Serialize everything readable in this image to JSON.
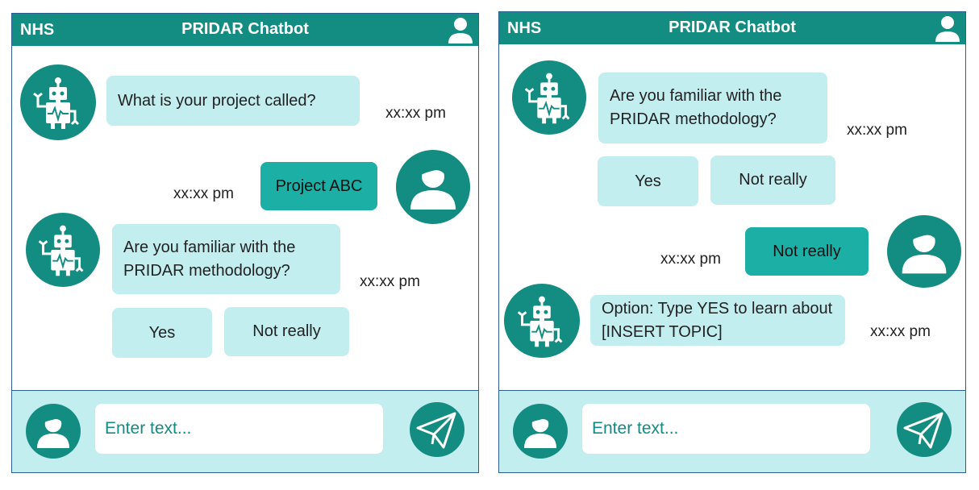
{
  "colors": {
    "header": "#138c82",
    "bubble_bot": "#c3eef0",
    "bubble_user": "#1bafa6",
    "footer": "#c3eef0",
    "border": "#2b5e8c"
  },
  "left": {
    "header": {
      "brand": "NHS",
      "title": "PRIDAR Chatbot",
      "user_icon": "user-icon"
    },
    "messages": [
      {
        "text": "What is your project called?",
        "time": "xx:xx pm"
      },
      {
        "text": "Project ABC",
        "time": "xx:xx pm"
      },
      {
        "text": "Are you familiar with the PRIDAR methodology?",
        "time": "xx:xx pm"
      }
    ],
    "options": [
      "Yes",
      "Not really"
    ],
    "footer": {
      "placeholder": "Enter text...",
      "send_icon": "paper-plane-icon"
    }
  },
  "right": {
    "header": {
      "brand": "NHS",
      "title": "PRIDAR Chatbot",
      "user_icon": "user-icon"
    },
    "messages": [
      {
        "text": "Are you familiar with the PRIDAR methodology?",
        "time": "xx:xx pm"
      },
      {
        "text": "Not really",
        "time": "xx:xx pm"
      },
      {
        "text": "Option: Type YES to learn about [INSERT TOPIC]",
        "time": "xx:xx pm"
      }
    ],
    "options": [
      "Yes",
      "Not really"
    ],
    "footer": {
      "placeholder": "Enter text...",
      "send_icon": "paper-plane-icon"
    }
  }
}
